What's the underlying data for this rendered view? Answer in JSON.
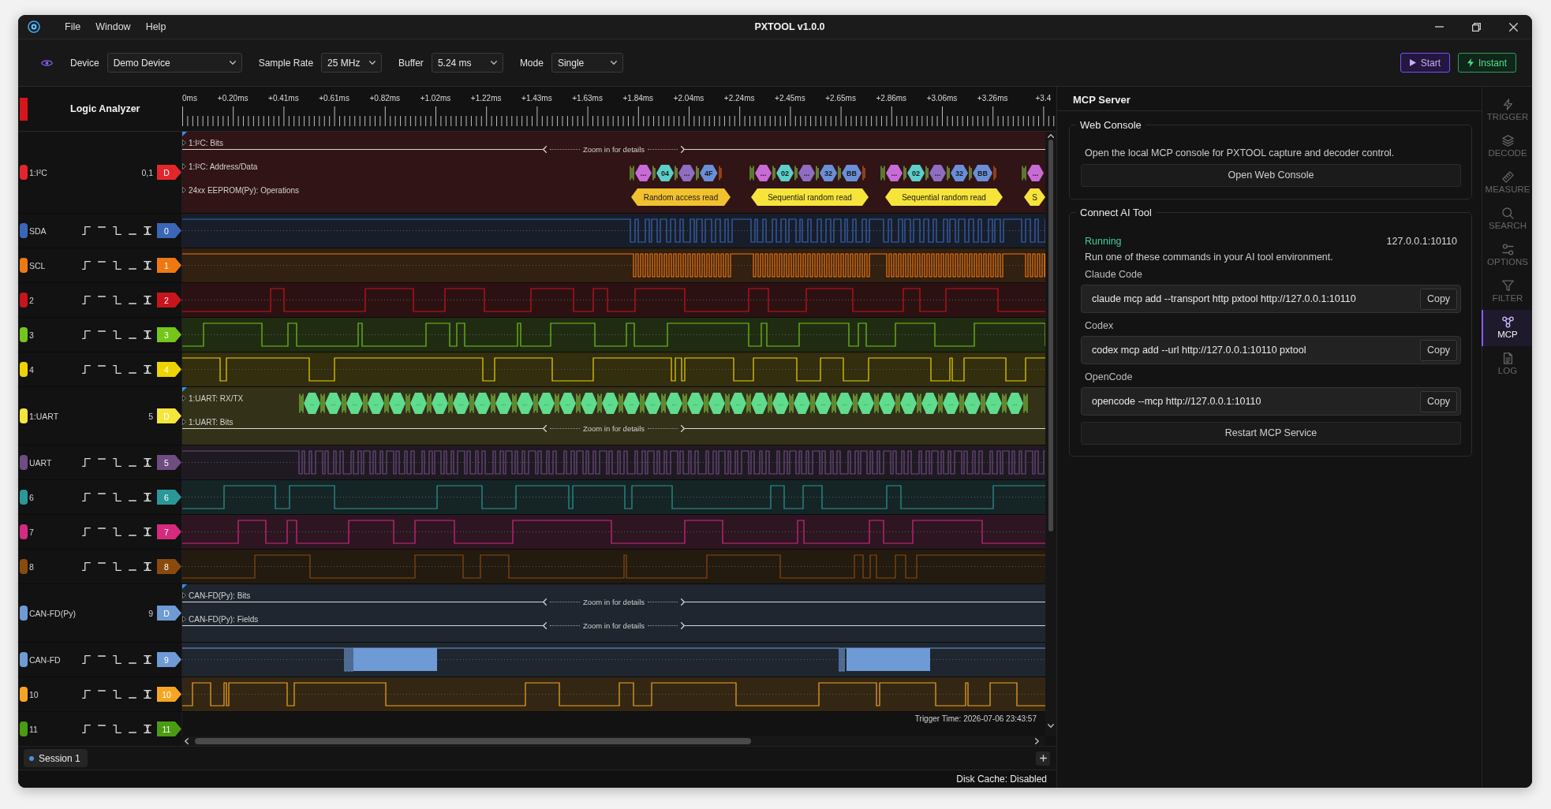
{
  "window": {
    "title": "PXTOOL v1.0.0",
    "menu": [
      "File",
      "Window",
      "Help"
    ]
  },
  "toolbar": {
    "fields": [
      {
        "label": "Device",
        "value": "Demo Device"
      },
      {
        "label": "Sample Rate",
        "value": "25 MHz"
      },
      {
        "label": "Buffer",
        "value": "5.24 ms"
      },
      {
        "label": "Mode",
        "value": "Single"
      }
    ],
    "buttons": [
      {
        "label": "Start",
        "kind": "start"
      },
      {
        "label": "Instant",
        "kind": "instant"
      }
    ]
  },
  "analyzer": {
    "title": "Logic Analyzer",
    "ruler": [
      "0ms",
      "+0.20ms",
      "+0.41ms",
      "+0.61ms",
      "+0.82ms",
      "+1.02ms",
      "+1.22ms",
      "+1.43ms",
      "+1.63ms",
      "+1.84ms",
      "+2.04ms",
      "+2.24ms",
      "+2.45ms",
      "+2.65ms",
      "+2.86ms",
      "+3.06ms",
      "+3.26ms",
      "+3.4"
    ],
    "channels": [
      {
        "kind": "decoder",
        "name": "1:I²C",
        "color": "#e4262c",
        "source": "0,1",
        "tag": "D",
        "tracks": [
          {
            "kind": "range",
            "label": "1:I²C: Bits",
            "hint": "Zoom in for details"
          },
          {
            "kind": "groups",
            "label": "1:I²C: Address/Data",
            "groups": [
              {
                "items": [
                  {
                    "text": "...",
                    "color": "#c86bd6"
                  },
                  {
                    "text": "04",
                    "color": "#5ccfc9"
                  },
                  {
                    "text": "...",
                    "color": "#8f6dc2"
                  },
                  {
                    "text": "4F",
                    "color": "#6a8fd9"
                  }
                ]
              },
              {
                "items": [
                  {
                    "text": "...",
                    "color": "#c86bd6"
                  },
                  {
                    "text": "02",
                    "color": "#5ccfc9"
                  },
                  {
                    "text": "...",
                    "color": "#8f6dc2"
                  },
                  {
                    "text": "32",
                    "color": "#6a8fd9"
                  },
                  {
                    "text": "BB",
                    "color": "#6a8fd9"
                  }
                ]
              },
              {
                "items": [
                  {
                    "text": "...",
                    "color": "#c86bd6"
                  },
                  {
                    "text": "02",
                    "color": "#5ccfc9"
                  },
                  {
                    "text": "...",
                    "color": "#8f6dc2"
                  },
                  {
                    "text": "32",
                    "color": "#6a8fd9"
                  },
                  {
                    "text": "BB",
                    "color": "#6a8fd9"
                  }
                ]
              },
              {
                "items": [
                  {
                    "text": "...",
                    "color": "#c86bd6"
                  }
                ]
              }
            ]
          },
          {
            "kind": "spans",
            "label": "24xx EEPROM(Py): Operations",
            "items": [
              {
                "text": "Random access read",
                "color": "#f2c12e"
              },
              {
                "text": "Sequential random read",
                "color": "#f7e43a"
              },
              {
                "text": "Sequential random read",
                "color": "#f7e43a"
              },
              {
                "text": "S",
                "color": "#f7e43a"
              }
            ]
          }
        ]
      },
      {
        "kind": "digital",
        "name": "SDA",
        "color": "#3b66b8",
        "tag": "0"
      },
      {
        "kind": "digital",
        "name": "SCL",
        "color": "#f07812",
        "tag": "1"
      },
      {
        "kind": "digital",
        "name": "2",
        "color": "#c8141c",
        "tag": "2"
      },
      {
        "kind": "digital",
        "name": "3",
        "color": "#74c61a",
        "tag": "3"
      },
      {
        "kind": "digital",
        "name": "4",
        "color": "#eed400",
        "tag": "4"
      },
      {
        "kind": "decoder",
        "name": "1:UART",
        "color": "#f6e63c",
        "source": "5",
        "tag": "D",
        "tracks": [
          {
            "kind": "stream",
            "label": "1:UART: RX/TX",
            "items": [
              "...",
              "...",
              "...",
              "...",
              "...",
              "...",
              "...",
              "...",
              "...",
              "...",
              "...",
              "...",
              "...",
              "...",
              "...",
              "...",
              "...",
              "...",
              "...",
              "...",
              "...",
              "...",
              "...",
              "...",
              "...",
              "...",
              "...",
              "...",
              "...",
              "...",
              "...",
              "...",
              "...",
              "..."
            ]
          },
          {
            "kind": "range",
            "label": "1:UART: Bits",
            "hint": "Zoom in for details"
          }
        ]
      },
      {
        "kind": "digital",
        "name": "UART",
        "color": "#6f4c82",
        "tag": "5"
      },
      {
        "kind": "digital",
        "name": "6",
        "color": "#2a9898",
        "tag": "6"
      },
      {
        "kind": "digital",
        "name": "7",
        "color": "#d42a80",
        "tag": "7"
      },
      {
        "kind": "digital",
        "name": "8",
        "color": "#8a4a0c",
        "tag": "8"
      },
      {
        "kind": "decoder",
        "name": "CAN-FD(Py)",
        "color": "#6e9ad6",
        "source": "9",
        "tag": "D",
        "tracks": [
          {
            "kind": "range",
            "label": "CAN-FD(Py): Bits",
            "hint": "Zoom in for details"
          },
          {
            "kind": "range",
            "label": "CAN-FD(Py): Fields",
            "hint": "Zoom in for details"
          }
        ]
      },
      {
        "kind": "digital",
        "name": "CAN-FD",
        "color": "#6e9ad6",
        "tag": "9"
      },
      {
        "kind": "digital",
        "name": "10",
        "color": "#f6a523",
        "tag": "10"
      },
      {
        "kind": "digital",
        "name": "11",
        "color": "#4a9c12",
        "tag": "11"
      }
    ],
    "trigger_time": "Trigger Time: 2026-07-06 23:43:57"
  },
  "sessions": [
    {
      "label": "Session 1",
      "selected": true
    }
  ],
  "status_bar": {
    "text": "Disk Cache: Disabled"
  },
  "mcp_panel": {
    "title": "MCP Server",
    "web_console": {
      "legend": "Web Console",
      "description": "Open the local MCP console for PXTOOL capture and decoder control.",
      "button": "Open Web Console"
    },
    "connect": {
      "legend": "Connect AI Tool",
      "status": "Running",
      "address": "127.0.0.1:10110",
      "description": "Run one of these commands in your AI tool environment.",
      "commands": [
        {
          "label": "Claude Code",
          "command": "claude mcp add --transport http pxtool http://127.0.0.1:10110",
          "button": "Copy"
        },
        {
          "label": "Codex",
          "command": "codex mcp add --url http://127.0.0.1:10110 pxtool",
          "button": "Copy"
        },
        {
          "label": "OpenCode",
          "command": "opencode --mcp http://127.0.0.1:10110",
          "button": "Copy"
        }
      ],
      "button": "Restart MCP Service"
    }
  },
  "rail": [
    {
      "label": "TRIGGER",
      "selected": false
    },
    {
      "label": "DECODE",
      "selected": false
    },
    {
      "label": "MEASURE",
      "selected": false
    },
    {
      "label": "SEARCH",
      "selected": false
    },
    {
      "label": "OPTIONS",
      "selected": false
    },
    {
      "label": "FILTER",
      "selected": false
    },
    {
      "label": "MCP",
      "selected": true
    },
    {
      "label": "LOG",
      "selected": false
    }
  ]
}
